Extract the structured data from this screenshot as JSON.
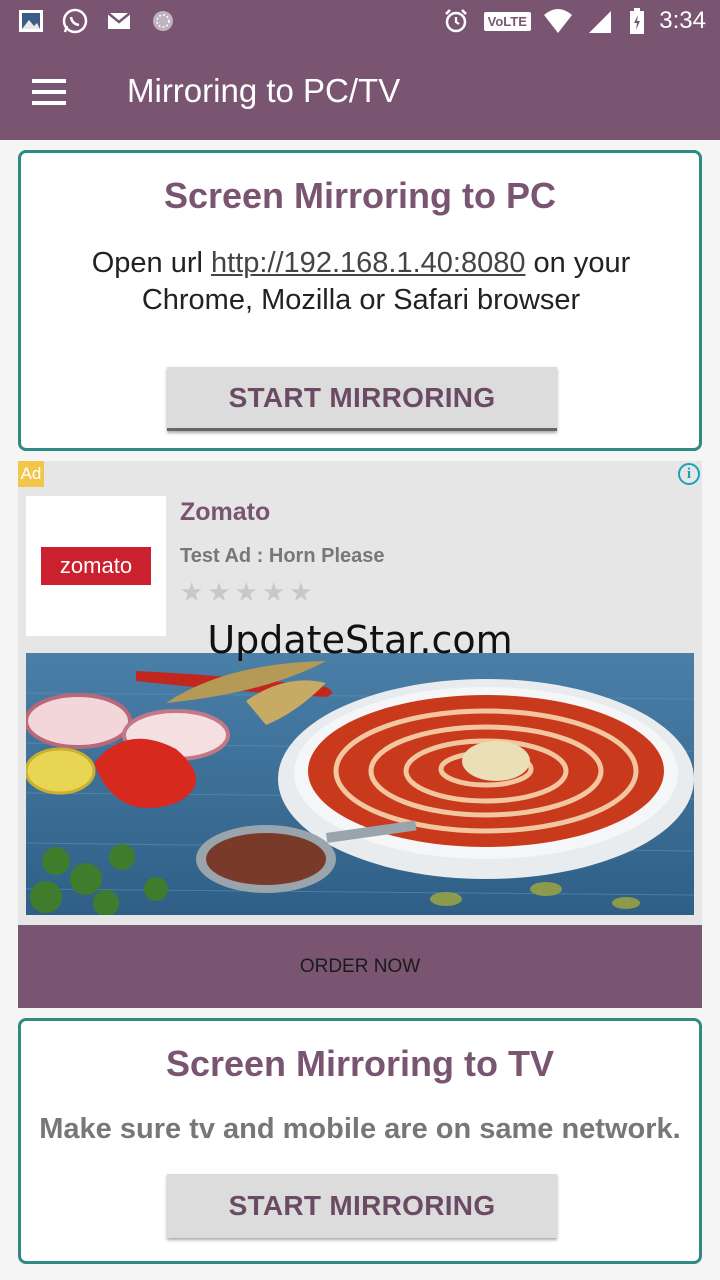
{
  "status_bar": {
    "time": "3:34",
    "volte_label": "VoLTE",
    "icons": [
      "gallery-icon",
      "whatsapp-icon",
      "gmail-icon",
      "app-icon",
      "alarm-icon",
      "volte-icon",
      "wifi-icon",
      "signal-icon",
      "battery-icon"
    ]
  },
  "app_bar": {
    "title": "Mirroring to PC/TV"
  },
  "pc_card": {
    "title": "Screen Mirroring to PC",
    "desc_prefix": "Open url ",
    "url": "http://192.168.1.40:8080",
    "desc_suffix": " on your Chrome, Mozilla or Safari browser",
    "button_label": "START MIRRORING"
  },
  "ad": {
    "badge": "Ad",
    "info": "i",
    "logo_text": "zomato",
    "name": "Zomato",
    "tagline": "Test Ad : Horn Please",
    "rating_stars": 0,
    "rating_max": 5,
    "cta_label": "ORDER NOW"
  },
  "watermark": "UpdateStar.com",
  "tv_card": {
    "title": "Screen Mirroring to TV",
    "desc": "Make sure tv and mobile are on same network.",
    "button_label": "START MIRRORING"
  },
  "colors": {
    "primary": "#7a5572",
    "card_border": "#2f8a84",
    "button_bg": "#dcdcdc",
    "ad_badge": "#f3c64a",
    "zomato_red": "#cb202d"
  }
}
